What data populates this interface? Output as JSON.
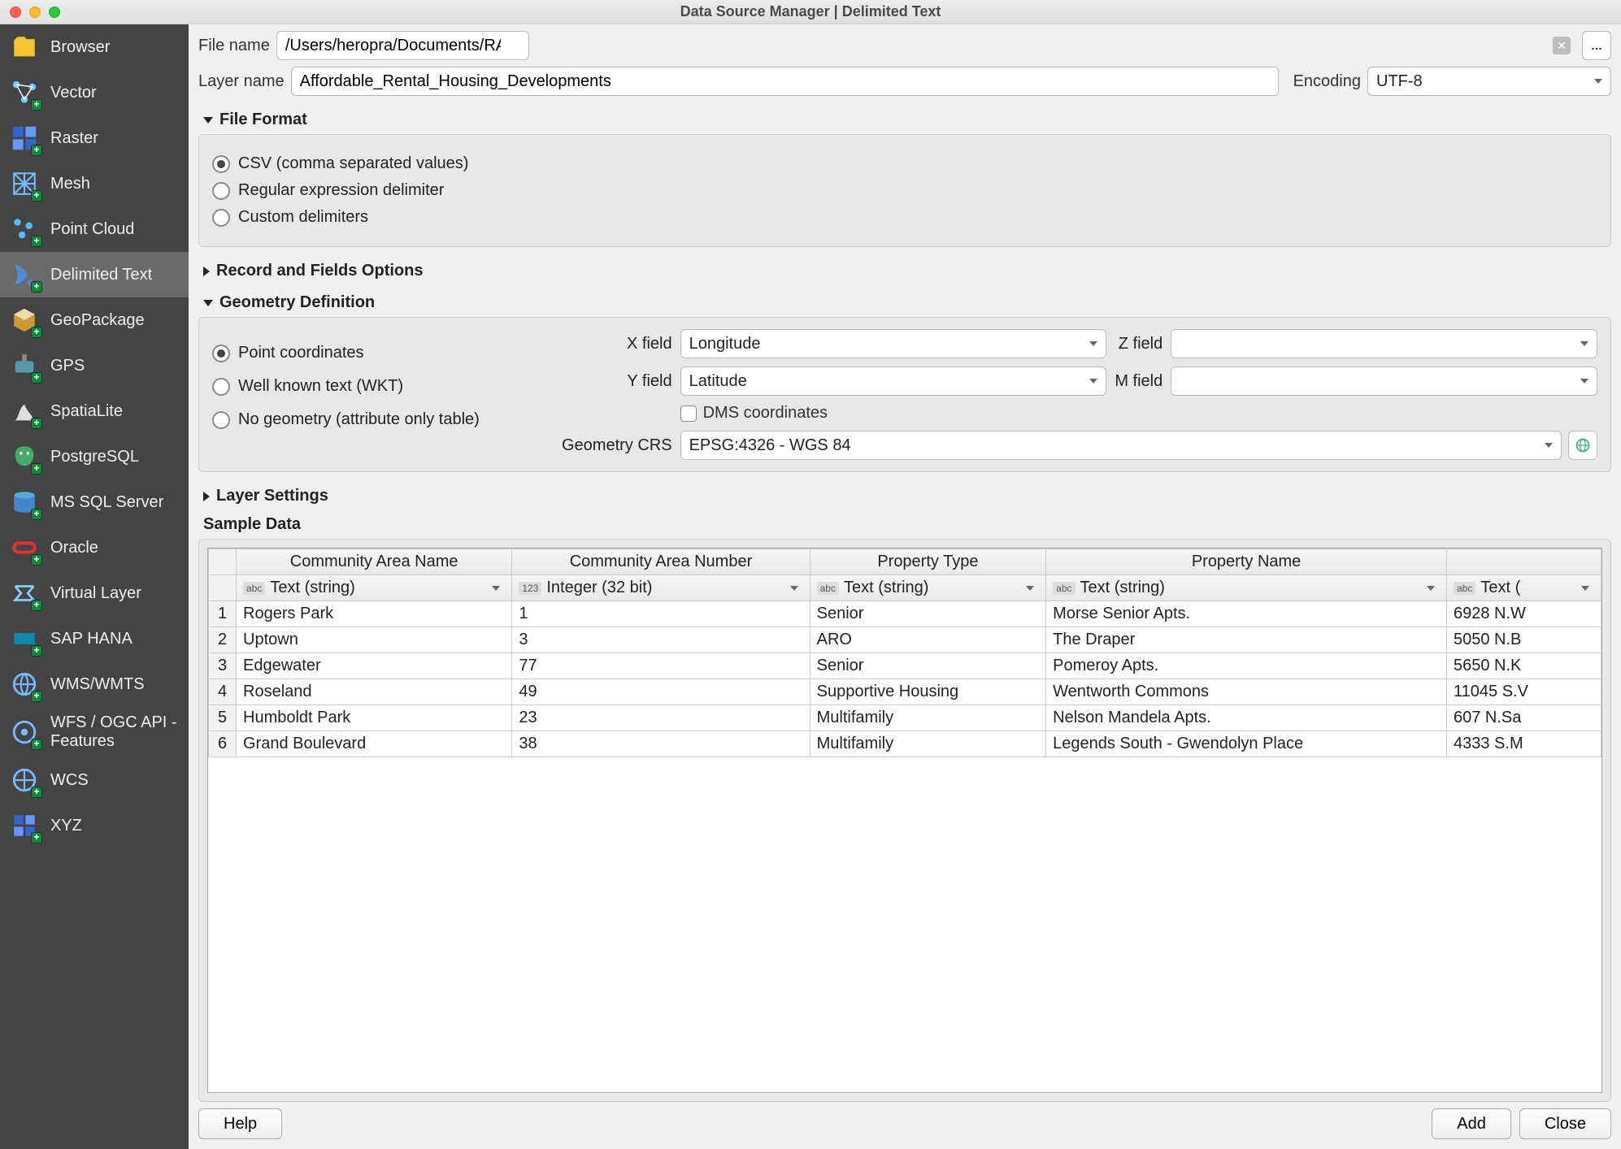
{
  "window_title": "Data Source Manager | Delimited Text",
  "sidebar": {
    "items": [
      {
        "label": "Browser",
        "selected": false
      },
      {
        "label": "Vector",
        "selected": false
      },
      {
        "label": "Raster",
        "selected": false
      },
      {
        "label": "Mesh",
        "selected": false
      },
      {
        "label": "Point Cloud",
        "selected": false
      },
      {
        "label": "Delimited Text",
        "selected": true
      },
      {
        "label": "GeoPackage",
        "selected": false
      },
      {
        "label": "GPS",
        "selected": false
      },
      {
        "label": "SpatiaLite",
        "selected": false
      },
      {
        "label": "PostgreSQL",
        "selected": false
      },
      {
        "label": "MS SQL Server",
        "selected": false
      },
      {
        "label": "Oracle",
        "selected": false
      },
      {
        "label": "Virtual Layer",
        "selected": false
      },
      {
        "label": "SAP HANA",
        "selected": false
      },
      {
        "label": "WMS/WMTS",
        "selected": false
      },
      {
        "label": "WFS / OGC API - Features",
        "selected": false
      },
      {
        "label": "WCS",
        "selected": false
      },
      {
        "label": "XYZ",
        "selected": false
      }
    ]
  },
  "labels": {
    "file_name": "File name",
    "layer_name": "Layer name",
    "encoding": "Encoding",
    "file_format_hdr": "File Format",
    "record_fields_hdr": "Record and Fields Options",
    "geometry_hdr": "Geometry Definition",
    "layer_settings_hdr": "Layer Settings",
    "sample_data_hdr": "Sample Data",
    "x_field": "X field",
    "y_field": "Y field",
    "z_field": "Z field",
    "m_field": "M field",
    "dms": "DMS coordinates",
    "geom_crs": "Geometry CRS",
    "browse_btn": "…"
  },
  "inputs": {
    "file_name": "/Users/heropra/Documents/RA Work/PlaceProjectDataWrangling/Affordable_Rental_Housing_Developments.csv",
    "layer_name": "Affordable_Rental_Housing_Developments",
    "encoding": "UTF-8"
  },
  "file_format": {
    "options": [
      {
        "label": "CSV (comma separated values)",
        "checked": true
      },
      {
        "label": "Regular expression delimiter",
        "checked": false
      },
      {
        "label": "Custom delimiters",
        "checked": false
      }
    ]
  },
  "geometry": {
    "options": [
      {
        "label": "Point coordinates",
        "checked": true
      },
      {
        "label": "Well known text (WKT)",
        "checked": false
      },
      {
        "label": "No geometry (attribute only table)",
        "checked": false
      }
    ],
    "x_field": "Longitude",
    "y_field": "Latitude",
    "z_field": "",
    "m_field": "",
    "dms_checked": false,
    "crs": "EPSG:4326 - WGS 84"
  },
  "sample": {
    "columns": [
      "Community Area Name",
      "Community Area Number",
      "Property Type",
      "Property Name",
      ""
    ],
    "column_types": [
      {
        "badge": "abc",
        "label": "Text (string)"
      },
      {
        "badge": "123",
        "label": "Integer (32 bit)"
      },
      {
        "badge": "abc",
        "label": "Text (string)"
      },
      {
        "badge": "abc",
        "label": "Text (string)"
      },
      {
        "badge": "abc",
        "label": "Text ("
      }
    ],
    "rows": [
      {
        "n": 1,
        "cells": [
          "Rogers Park",
          "1",
          "Senior",
          "Morse Senior Apts.",
          "6928 N.W"
        ]
      },
      {
        "n": 2,
        "cells": [
          "Uptown",
          "3",
          "ARO",
          "The Draper",
          "5050 N.B"
        ]
      },
      {
        "n": 3,
        "cells": [
          "Edgewater",
          "77",
          "Senior",
          "Pomeroy Apts.",
          "5650 N.K"
        ]
      },
      {
        "n": 4,
        "cells": [
          "Roseland",
          "49",
          "Supportive Housing",
          "Wentworth Commons",
          "11045 S.V"
        ]
      },
      {
        "n": 5,
        "cells": [
          "Humboldt Park",
          "23",
          "Multifamily",
          "Nelson Mandela Apts.",
          "607 N.Sa"
        ]
      },
      {
        "n": 6,
        "cells": [
          "Grand Boulevard",
          "38",
          "Multifamily",
          "Legends South - Gwendolyn Place",
          "4333 S.M"
        ]
      }
    ]
  },
  "buttons": {
    "help": "Help",
    "add": "Add",
    "close": "Close"
  }
}
